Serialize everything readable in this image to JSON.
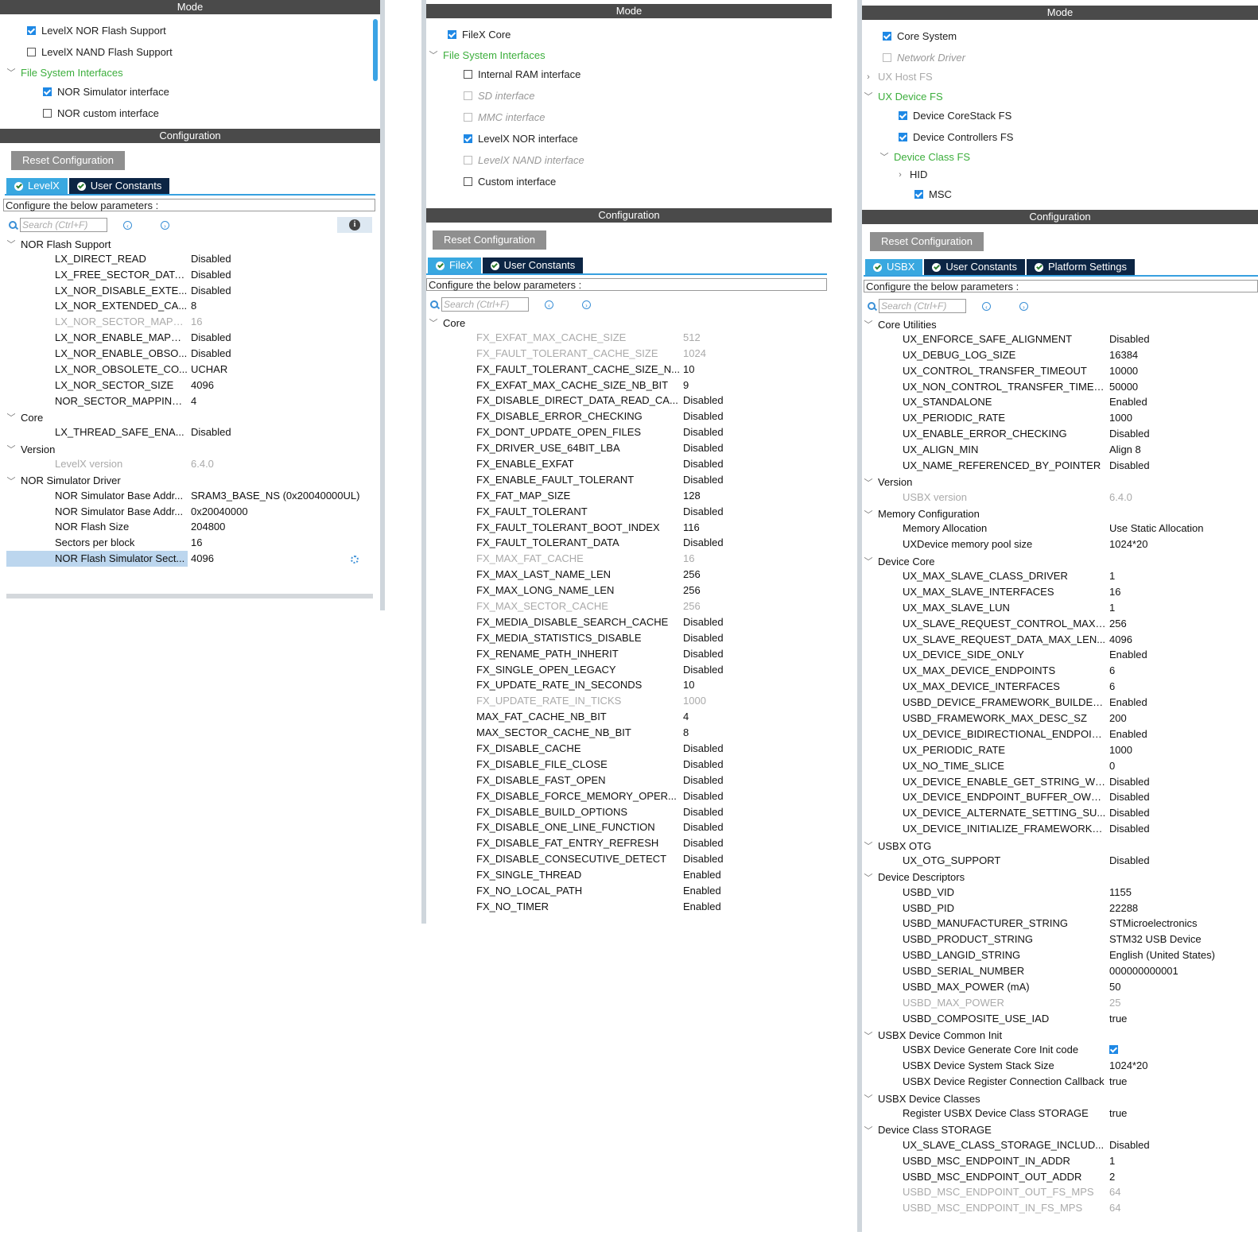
{
  "common": {
    "mode_title": "Mode",
    "config_title": "Configuration",
    "reset_label": "Reset Configuration",
    "configure_label": "Configure the below parameters :",
    "search_placeholder": "Search (Ctrl+F)"
  },
  "p1": {
    "mode_items": [
      {
        "label": "LevelX NOR Flash Support",
        "checked": true
      },
      {
        "label": "LevelX NAND Flash Support",
        "checked": false
      },
      {
        "label": "File System Interfaces"
      },
      {
        "label": "NOR Simulator interface",
        "checked": true
      },
      {
        "label": "NOR custom interface",
        "checked": false
      }
    ],
    "tabs": [
      "LevelX",
      "User Constants"
    ],
    "sections": [
      {
        "title": "NOR Flash Support",
        "rows": [
          {
            "name": "LX_DIRECT_READ",
            "value": "Disabled"
          },
          {
            "name": "LX_FREE_SECTOR_DATA...",
            "value": "Disabled"
          },
          {
            "name": "LX_NOR_DISABLE_EXTE...",
            "value": "Disabled"
          },
          {
            "name": "LX_NOR_EXTENDED_CA...",
            "value": "8"
          },
          {
            "name": "LX_NOR_SECTOR_MAPPI...",
            "value": "16",
            "disabled": true
          },
          {
            "name": "LX_NOR_ENABLE_MAPPI...",
            "value": "Disabled"
          },
          {
            "name": "LX_NOR_ENABLE_OBSO...",
            "value": "Disabled"
          },
          {
            "name": "LX_NOR_OBSOLETE_CO...",
            "value": "UCHAR"
          },
          {
            "name": "LX_NOR_SECTOR_SIZE",
            "value": "4096"
          },
          {
            "name": "NOR_SECTOR_MAPPING...",
            "value": "4"
          }
        ]
      },
      {
        "title": "Core",
        "rows": [
          {
            "name": "LX_THREAD_SAFE_ENA...",
            "value": "Disabled"
          }
        ]
      },
      {
        "title": "Version",
        "rows": [
          {
            "name": "LevelX version",
            "value": "6.4.0",
            "disabled": true
          }
        ]
      },
      {
        "title": "NOR Simulator Driver",
        "rows": [
          {
            "name": "NOR Simulator Base Addr...",
            "value": "SRAM3_BASE_NS (0x20040000UL)"
          },
          {
            "name": "NOR Simulator Base Addr...",
            "value": "0x20040000"
          },
          {
            "name": "NOR Flash Size",
            "value": "204800"
          },
          {
            "name": "Sectors per block",
            "value": "16"
          },
          {
            "name": "NOR Flash Simulator Sect...",
            "value": "4096",
            "selected": true
          }
        ]
      }
    ]
  },
  "p2": {
    "mode_items": [
      {
        "label": "FileX Core",
        "checked": true
      },
      {
        "label": "File System Interfaces"
      },
      {
        "label": "Internal RAM interface",
        "checked": false
      },
      {
        "label": "SD interface",
        "checked": false,
        "disabled": true
      },
      {
        "label": "MMC interface",
        "checked": false,
        "disabled": true
      },
      {
        "label": "LevelX NOR interface",
        "checked": true
      },
      {
        "label": "LevelX NAND interface",
        "checked": false,
        "disabled": true
      },
      {
        "label": "Custom interface",
        "checked": false
      }
    ],
    "tabs": [
      "FileX",
      "User Constants"
    ],
    "sections": [
      {
        "title": "Core",
        "rows": [
          {
            "name": "FX_EXFAT_MAX_CACHE_SIZE",
            "value": "512",
            "disabled": true
          },
          {
            "name": "FX_FAULT_TOLERANT_CACHE_SIZE",
            "value": "1024",
            "disabled": true
          },
          {
            "name": "FX_FAULT_TOLERANT_CACHE_SIZE_N...",
            "value": "10"
          },
          {
            "name": "FX_EXFAT_MAX_CACHE_SIZE_NB_BIT",
            "value": "9"
          },
          {
            "name": "FX_DISABLE_DIRECT_DATA_READ_CA...",
            "value": "Disabled"
          },
          {
            "name": "FX_DISABLE_ERROR_CHECKING",
            "value": "Disabled"
          },
          {
            "name": "FX_DONT_UPDATE_OPEN_FILES",
            "value": "Disabled"
          },
          {
            "name": "FX_DRIVER_USE_64BIT_LBA",
            "value": "Disabled"
          },
          {
            "name": "FX_ENABLE_EXFAT",
            "value": "Disabled"
          },
          {
            "name": "FX_ENABLE_FAULT_TOLERANT",
            "value": "Disabled"
          },
          {
            "name": "FX_FAT_MAP_SIZE",
            "value": "128"
          },
          {
            "name": "FX_FAULT_TOLERANT",
            "value": "Disabled"
          },
          {
            "name": "FX_FAULT_TOLERANT_BOOT_INDEX",
            "value": "116"
          },
          {
            "name": "FX_FAULT_TOLERANT_DATA",
            "value": "Disabled"
          },
          {
            "name": "FX_MAX_FAT_CACHE",
            "value": "16",
            "disabled": true
          },
          {
            "name": "FX_MAX_LAST_NAME_LEN",
            "value": "256"
          },
          {
            "name": "FX_MAX_LONG_NAME_LEN",
            "value": "256"
          },
          {
            "name": "FX_MAX_SECTOR_CACHE",
            "value": "256",
            "disabled": true
          },
          {
            "name": "FX_MEDIA_DISABLE_SEARCH_CACHE",
            "value": "Disabled"
          },
          {
            "name": "FX_MEDIA_STATISTICS_DISABLE",
            "value": "Disabled"
          },
          {
            "name": "FX_RENAME_PATH_INHERIT",
            "value": "Disabled"
          },
          {
            "name": "FX_SINGLE_OPEN_LEGACY",
            "value": "Disabled"
          },
          {
            "name": "FX_UPDATE_RATE_IN_SECONDS",
            "value": "10"
          },
          {
            "name": "FX_UPDATE_RATE_IN_TICKS",
            "value": "1000",
            "disabled": true
          },
          {
            "name": "MAX_FAT_CACHE_NB_BIT",
            "value": "4"
          },
          {
            "name": "MAX_SECTOR_CACHE_NB_BIT",
            "value": "8"
          },
          {
            "name": "FX_DISABLE_CACHE",
            "value": "Disabled"
          },
          {
            "name": "FX_DISABLE_FILE_CLOSE",
            "value": "Disabled"
          },
          {
            "name": "FX_DISABLE_FAST_OPEN",
            "value": "Disabled"
          },
          {
            "name": "FX_DISABLE_FORCE_MEMORY_OPER...",
            "value": "Disabled"
          },
          {
            "name": "FX_DISABLE_BUILD_OPTIONS",
            "value": "Disabled"
          },
          {
            "name": "FX_DISABLE_ONE_LINE_FUNCTION",
            "value": "Disabled"
          },
          {
            "name": "FX_DISABLE_FAT_ENTRY_REFRESH",
            "value": "Disabled"
          },
          {
            "name": "FX_DISABLE_CONSECUTIVE_DETECT",
            "value": "Disabled"
          },
          {
            "name": "FX_SINGLE_THREAD",
            "value": "Enabled"
          },
          {
            "name": "FX_NO_LOCAL_PATH",
            "value": "Enabled"
          },
          {
            "name": "FX_NO_TIMER",
            "value": "Enabled"
          }
        ]
      }
    ]
  },
  "p3": {
    "mode_items": [
      {
        "label": "Core System",
        "checked": true
      },
      {
        "label": "Network Driver",
        "checked": false,
        "disabled": true
      },
      {
        "label": "UX Host FS"
      },
      {
        "label": "UX Device FS"
      },
      {
        "label": "Device CoreStack FS",
        "checked": true
      },
      {
        "label": "Device Controllers FS",
        "checked": true
      },
      {
        "label": "Device Class FS"
      },
      {
        "label": "HID"
      },
      {
        "label": "MSC",
        "checked": true
      }
    ],
    "tabs": [
      "USBX",
      "User Constants",
      "Platform Settings"
    ],
    "sections": [
      {
        "title": "Core Utilities",
        "rows": [
          {
            "name": "UX_ENFORCE_SAFE_ALIGNMENT",
            "value": "Disabled"
          },
          {
            "name": "UX_DEBUG_LOG_SIZE",
            "value": "16384"
          },
          {
            "name": "UX_CONTROL_TRANSFER_TIMEOUT",
            "value": "10000"
          },
          {
            "name": "UX_NON_CONTROL_TRANSFER_TIMEOUT",
            "value": "50000"
          },
          {
            "name": "UX_STANDALONE",
            "value": "Enabled"
          },
          {
            "name": "UX_PERIODIC_RATE",
            "value": "1000"
          },
          {
            "name": "UX_ENABLE_ERROR_CHECKING",
            "value": "Disabled"
          },
          {
            "name": "UX_ALIGN_MIN",
            "value": "Align 8"
          },
          {
            "name": "UX_NAME_REFERENCED_BY_POINTER",
            "value": "Disabled"
          }
        ]
      },
      {
        "title": "Version",
        "rows": [
          {
            "name": "USBX version",
            "value": "6.4.0",
            "disabled": true
          }
        ]
      },
      {
        "title": "Memory Configuration",
        "rows": [
          {
            "name": "Memory Allocation",
            "value": "Use Static Allocation"
          },
          {
            "name": "UXDevice memory pool size",
            "value": "1024*20"
          }
        ]
      },
      {
        "title": "Device Core",
        "rows": [
          {
            "name": "UX_MAX_SLAVE_CLASS_DRIVER",
            "value": "1"
          },
          {
            "name": "UX_MAX_SLAVE_INTERFACES",
            "value": "16"
          },
          {
            "name": "UX_MAX_SLAVE_LUN",
            "value": "1"
          },
          {
            "name": "UX_SLAVE_REQUEST_CONTROL_MAX_...",
            "value": "256"
          },
          {
            "name": "UX_SLAVE_REQUEST_DATA_MAX_LEN...",
            "value": "4096"
          },
          {
            "name": "UX_DEVICE_SIDE_ONLY",
            "value": "Enabled"
          },
          {
            "name": "UX_MAX_DEVICE_ENDPOINTS",
            "value": "6"
          },
          {
            "name": "UX_MAX_DEVICE_INTERFACES",
            "value": "6"
          },
          {
            "name": "USBD_DEVICE_FRAMEWORK_BUILDER...",
            "value": "Enabled"
          },
          {
            "name": "USBD_FRAMEWORK_MAX_DESC_SZ",
            "value": "200"
          },
          {
            "name": "UX_DEVICE_BIDIRECTIONAL_ENDPOINT...",
            "value": "Enabled"
          },
          {
            "name": "UX_PERIODIC_RATE",
            "value": "1000"
          },
          {
            "name": "UX_NO_TIME_SLICE",
            "value": "0"
          },
          {
            "name": "UX_DEVICE_ENABLE_GET_STRING_WIT...",
            "value": "Disabled"
          },
          {
            "name": "UX_DEVICE_ENDPOINT_BUFFER_OWNER",
            "value": "Disabled"
          },
          {
            "name": "UX_DEVICE_ALTERNATE_SETTING_SU...",
            "value": "Disabled"
          },
          {
            "name": "UX_DEVICE_INITIALIZE_FRAMEWORK_...",
            "value": "Disabled"
          }
        ]
      },
      {
        "title": "USBX OTG",
        "rows": [
          {
            "name": "UX_OTG_SUPPORT",
            "value": "Disabled"
          }
        ]
      },
      {
        "title": "Device Descriptors",
        "rows": [
          {
            "name": "USBD_VID",
            "value": "1155"
          },
          {
            "name": "USBD_PID",
            "value": "22288"
          },
          {
            "name": "USBD_MANUFACTURER_STRING",
            "value": "STMicroelectronics"
          },
          {
            "name": "USBD_PRODUCT_STRING",
            "value": "STM32 USB Device"
          },
          {
            "name": "USBD_LANGID_STRING",
            "value": "English (United States)"
          },
          {
            "name": "USBD_SERIAL_NUMBER",
            "value": "000000000001"
          },
          {
            "name": "USBD_MAX_POWER (mA)",
            "value": "50"
          },
          {
            "name": "USBD_MAX_POWER",
            "value": "25",
            "disabled": true
          },
          {
            "name": "USBD_COMPOSITE_USE_IAD",
            "value": "true"
          }
        ]
      },
      {
        "title": "USBX Device Common Init",
        "rows": [
          {
            "name": "USBX Device Generate Core Init code",
            "value": "",
            "check": true
          },
          {
            "name": "USBX Device System Stack Size",
            "value": "1024*20"
          },
          {
            "name": "USBX Device Register Connection Callback",
            "value": "true"
          }
        ]
      },
      {
        "title": "USBX Device Classes",
        "rows": [
          {
            "name": "Register USBX Device Class STORAGE",
            "value": "true"
          }
        ]
      },
      {
        "title": "Device Class STORAGE",
        "rows": [
          {
            "name": "UX_SLAVE_CLASS_STORAGE_INCLUD...",
            "value": "Disabled"
          },
          {
            "name": "USBD_MSC_ENDPOINT_IN_ADDR",
            "value": "1"
          },
          {
            "name": "USBD_MSC_ENDPOINT_OUT_ADDR",
            "value": "2"
          },
          {
            "name": "USBD_MSC_ENDPOINT_OUT_FS_MPS",
            "value": "64",
            "disabled": true
          },
          {
            "name": "USBD_MSC_ENDPOINT_IN_FS_MPS",
            "value": "64",
            "disabled": true
          }
        ]
      }
    ]
  }
}
